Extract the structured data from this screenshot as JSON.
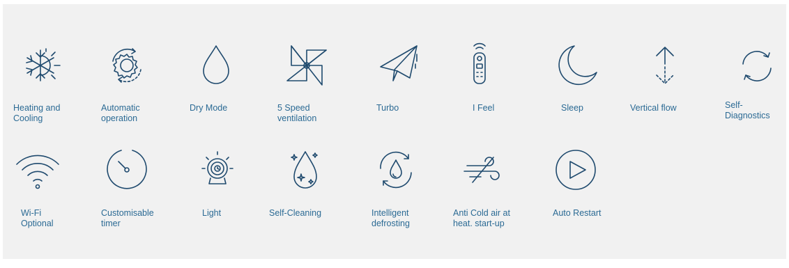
{
  "accent_color": "#2b6a94",
  "icon_color": "#1f4a6e",
  "panel_color": "#f1f1f1",
  "features": [
    {
      "label": "Heating and\nCooling",
      "icon": "snowflake-sun-icon"
    },
    {
      "label": "Automatic\noperation",
      "icon": "gear-cycle-icon"
    },
    {
      "label": "Dry Mode",
      "icon": "water-drop-icon"
    },
    {
      "label": "5 Speed\nventilation",
      "icon": "pinwheel-icon"
    },
    {
      "label": "Turbo",
      "icon": "paper-plane-icon"
    },
    {
      "label": "I Feel",
      "icon": "remote-control-icon"
    },
    {
      "label": "Sleep",
      "icon": "crescent-moon-icon"
    },
    {
      "label": "Vertical flow",
      "icon": "vertical-arrows-icon"
    },
    {
      "label": "Self-\nDiagnostics",
      "icon": "refresh-arrows-icon"
    },
    {
      "label": "Wi-Fi\nOptional",
      "icon": "wifi-icon"
    },
    {
      "label": "Customisable\ntimer",
      "icon": "timer-dial-icon"
    },
    {
      "label": "Light",
      "icon": "light-lamp-icon"
    },
    {
      "label": "Self-Cleaning",
      "icon": "sparkle-drop-icon"
    },
    {
      "label": "Intelligent\ndefrosting",
      "icon": "defrost-cycle-icon"
    },
    {
      "label": "Anti Cold air at\nheat. start-up",
      "icon": "wind-icon"
    },
    {
      "label": "Auto Restart",
      "icon": "play-circle-icon"
    }
  ]
}
